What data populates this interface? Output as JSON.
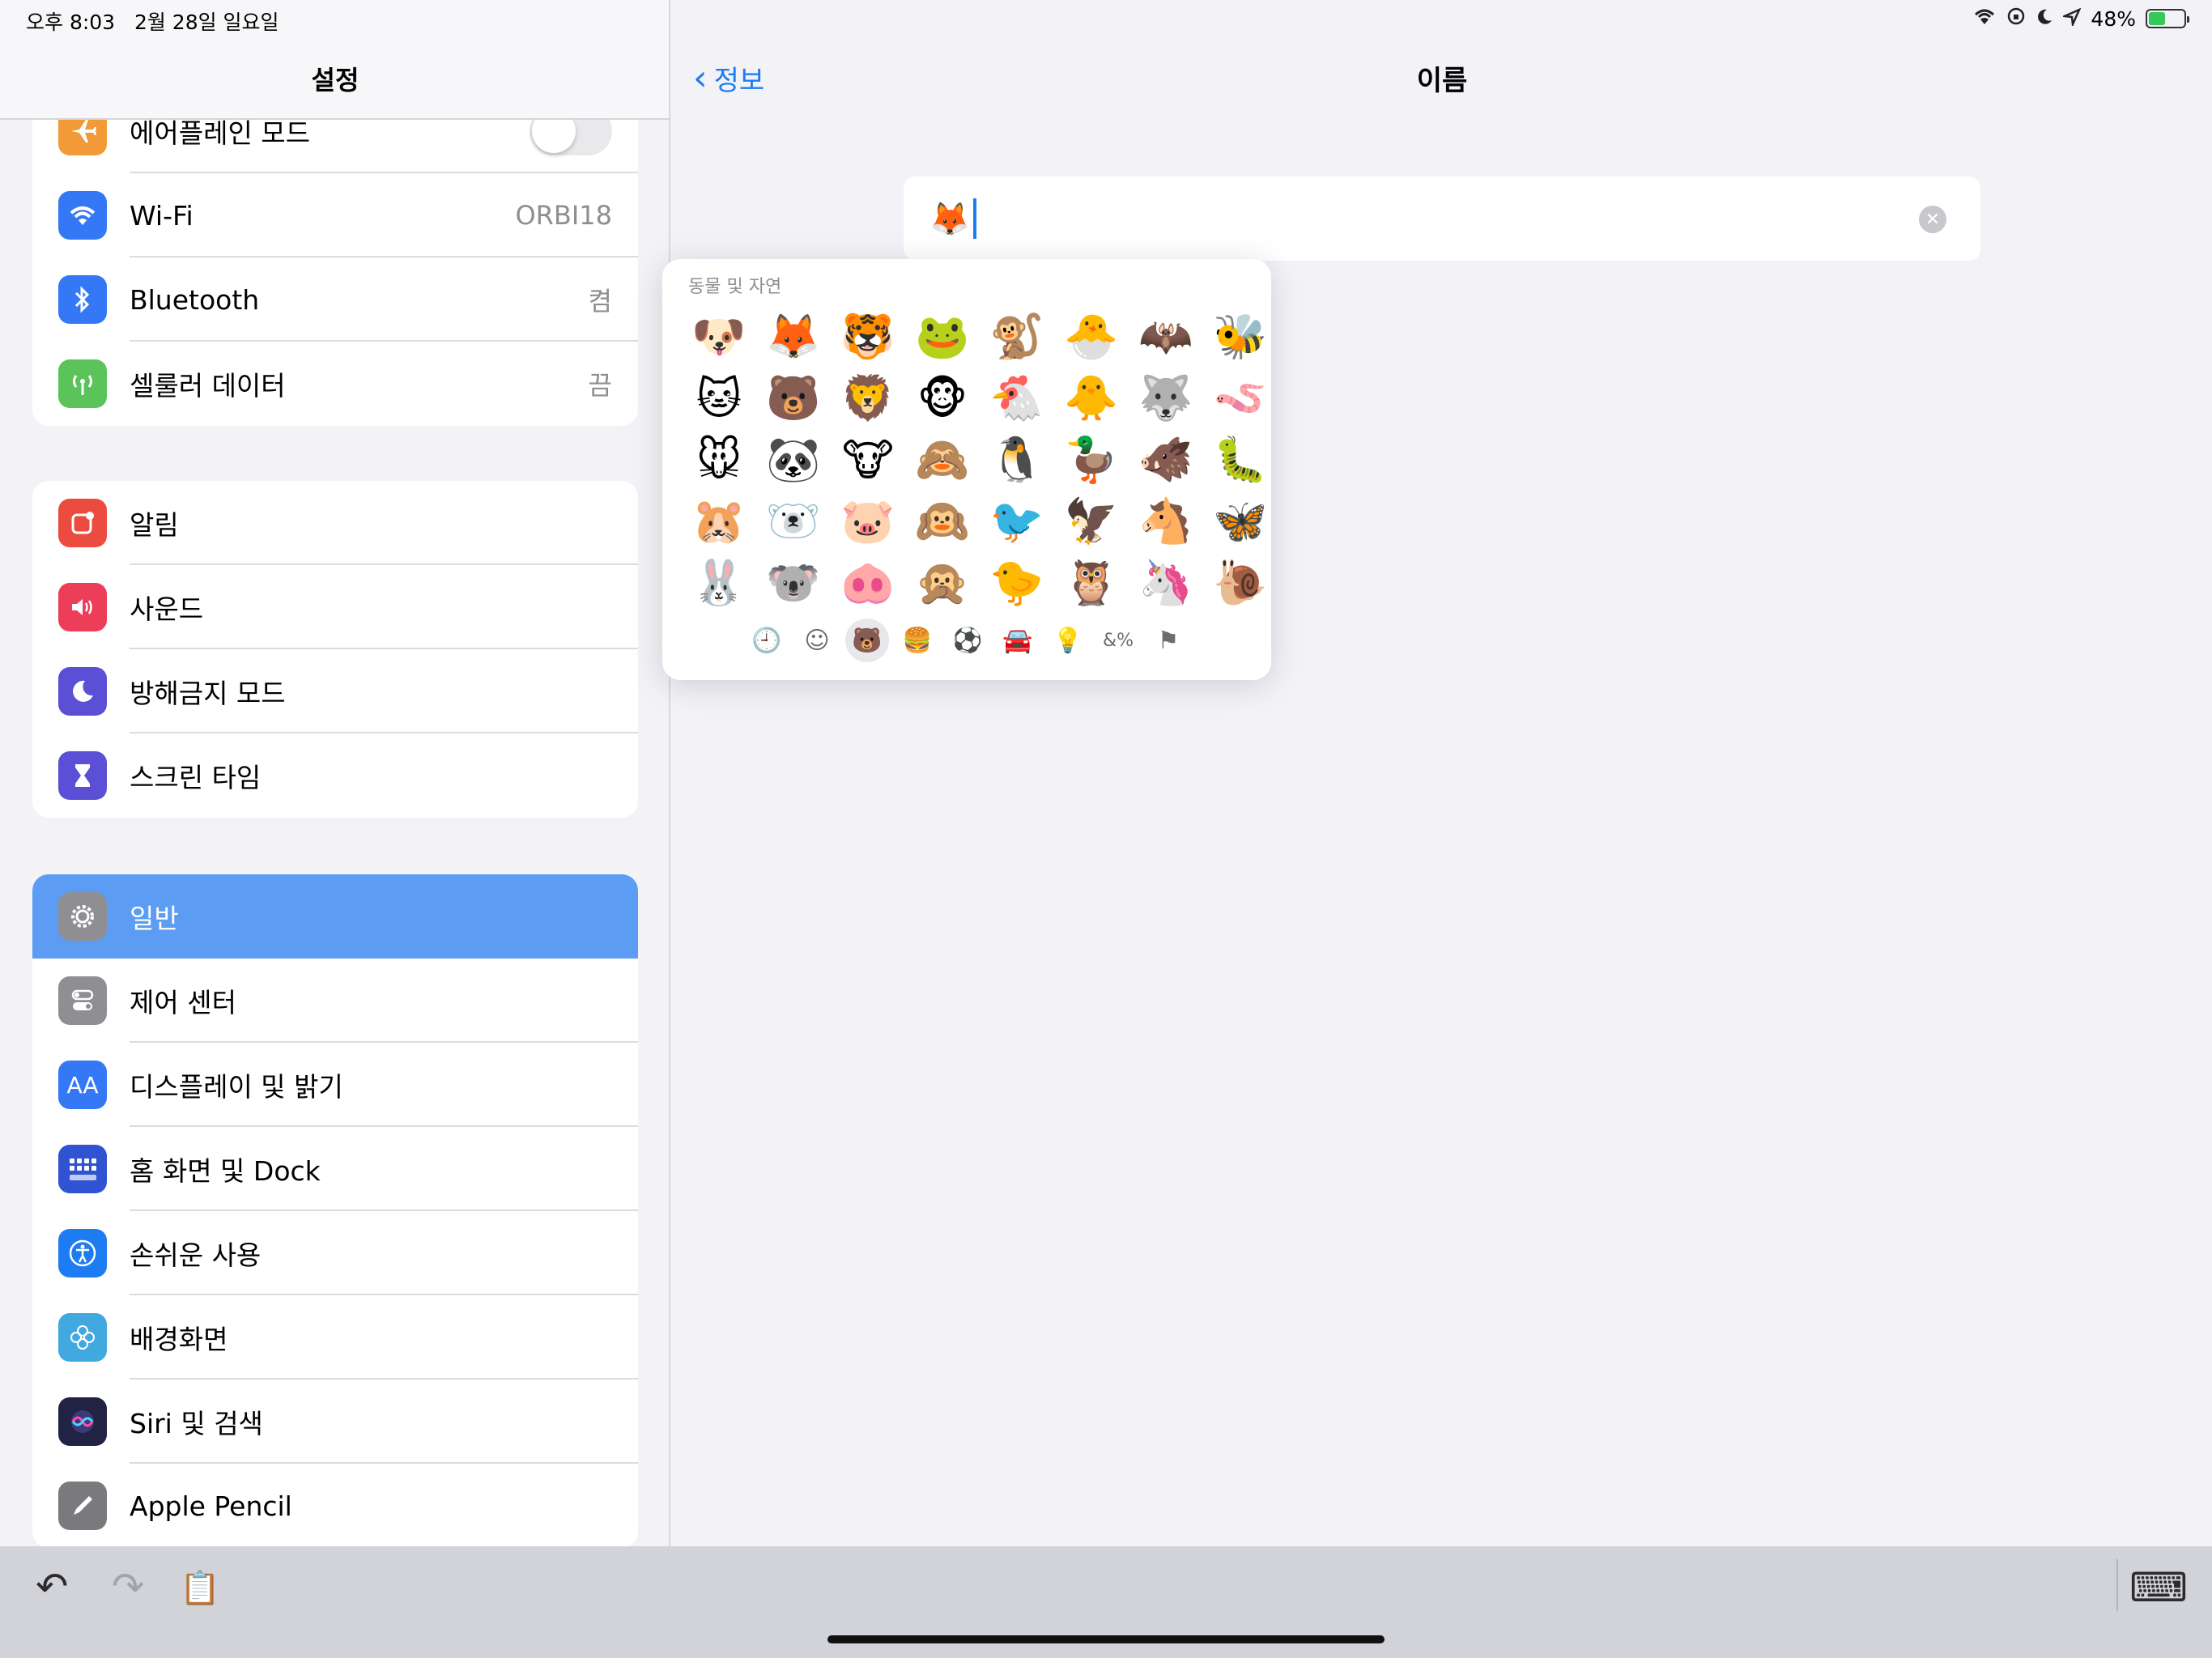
{
  "status": {
    "time": "오후 8:03",
    "date": "2월 28일 일요일",
    "battery": "48%",
    "battery_level": 0.48,
    "icons": [
      "wifi-icon",
      "orientation-lock-icon",
      "moon-icon",
      "location-icon",
      "battery-icon"
    ]
  },
  "sidebar": {
    "title": "설정",
    "group1": [
      {
        "label": "에어플레인 모드",
        "icon": "airplane-icon",
        "color": "#f29a38",
        "toggle": false
      },
      {
        "label": "Wi-Fi",
        "icon": "wifi-icon",
        "color": "#3478f6",
        "value": "ORBI18"
      },
      {
        "label": "Bluetooth",
        "icon": "bluetooth-icon",
        "color": "#3478f6",
        "value": "켬"
      },
      {
        "label": "셀룰러 데이터",
        "icon": "antenna-icon",
        "color": "#5ac35a",
        "value": "끔"
      }
    ],
    "group2": [
      {
        "label": "알림",
        "icon": "notifications-icon",
        "color": "#ec4b3f"
      },
      {
        "label": "사운드",
        "icon": "speaker-icon",
        "color": "#ec3d59"
      },
      {
        "label": "방해금지 모드",
        "icon": "moon-icon",
        "color": "#5b4fd6"
      },
      {
        "label": "스크린 타임",
        "icon": "hourglass-icon",
        "color": "#5b4fd6"
      }
    ],
    "group3": [
      {
        "label": "일반",
        "icon": "gear-icon",
        "color": "#8e8e93",
        "selected": true
      },
      {
        "label": "제어 센터",
        "icon": "switches-icon",
        "color": "#8e8e93"
      },
      {
        "label": "디스플레이 및 밝기",
        "icon": "display-icon",
        "color": "#3478f6",
        "glyph": "AA"
      },
      {
        "label": "홈 화면 및 Dock",
        "icon": "home-grid-icon",
        "color": "#2f53d1"
      },
      {
        "label": "손쉬운 사용",
        "icon": "accessibility-icon",
        "color": "#1e7cf2"
      },
      {
        "label": "배경화면",
        "icon": "flower-icon",
        "color": "#42a8e0"
      },
      {
        "label": "Siri 및 검색",
        "icon": "siri-icon",
        "color": "#222244"
      },
      {
        "label": "Apple Pencil",
        "icon": "pencil-icon",
        "color": "#7a7a7e"
      }
    ]
  },
  "detail": {
    "back_label": "정보",
    "title": "이름",
    "field_value": "🦊"
  },
  "emoji_picker": {
    "section": "동물 및 자연",
    "emojis": [
      "🐶",
      "🦊",
      "🐯",
      "🐸",
      "🐒",
      "🐣",
      "🦇",
      "🐝",
      "🐱",
      "🐻",
      "🦁",
      "🐵",
      "🐔",
      "🐥",
      "🐺",
      "🪱",
      "🐭",
      "🐼",
      "🐮",
      "🙈",
      "🐧",
      "🦆",
      "🐗",
      "🐛",
      "🐹",
      "🐻‍❄️",
      "🐷",
      "🙉",
      "🐦",
      "🦅",
      "🐴",
      "🦋",
      "🐰",
      "🐨",
      "🐽",
      "🙊",
      "🐤",
      "🦉",
      "🦄",
      "🐌"
    ],
    "categories": [
      "🕘",
      "☺",
      "🐻",
      "🍔",
      "⚽",
      "🚘",
      "💡",
      "&%",
      "⚑"
    ]
  },
  "toolbar": {
    "undo": "↶",
    "redo": "↷",
    "paste": "📋",
    "keyboard": "⌨"
  },
  "colors": {
    "accent": "#1e7cf2",
    "selected_row": "#5c9df3"
  }
}
